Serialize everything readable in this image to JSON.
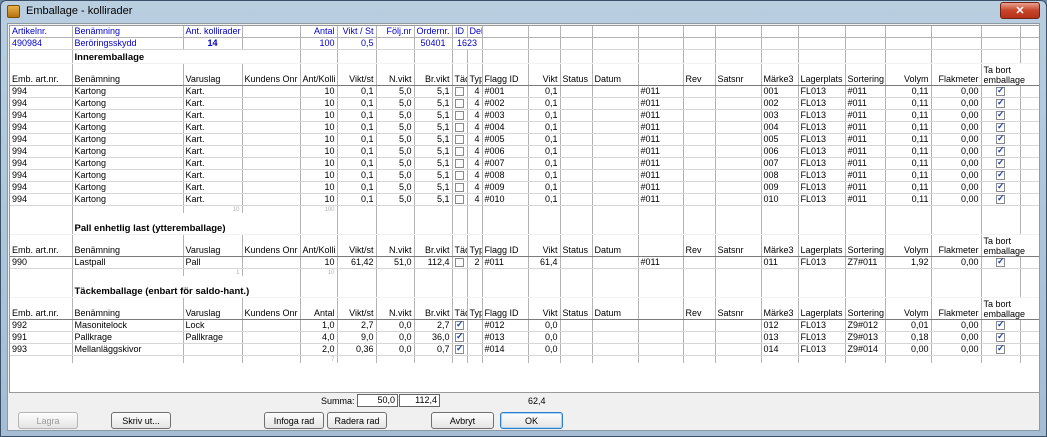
{
  "window": {
    "title": "Emballage - kollirader",
    "close_glyph": "✕"
  },
  "header": {
    "labels": [
      "Artikelnr.",
      "Benämning",
      "Ant. kollirader",
      "Antal",
      "Vikt / St",
      "Följ.nr",
      "Ordernr.",
      "ID",
      "Del"
    ],
    "values": {
      "artikelnr": "490984",
      "benamning": "Beröringsskydd",
      "ant_kollirader": "14",
      "antal": "100",
      "vikt_st": "0,5",
      "ordernr": "50401",
      "id": "1623"
    }
  },
  "sections": [
    {
      "title": "Inneremballage",
      "columns": [
        "Emb. art.nr.",
        "Benämning",
        "Varuslag",
        "Kundens Onr",
        "Ant/Kolli",
        "Vikt/st",
        "N.vikt",
        "Br.vikt",
        "Täck.",
        "Typ",
        "Flagg ID",
        "Vikt",
        "Status",
        "Datum",
        "",
        "Rev",
        "Satsnr",
        "Märke3",
        "Lagerplats",
        "Sortering",
        "Volym",
        "Flakmeter",
        "Ta bort emballage"
      ],
      "rows": [
        [
          "994",
          "Kartong",
          "Kart.",
          "",
          "10",
          "0,1",
          "5,0",
          "5,1",
          false,
          "4",
          "#001",
          "0,1",
          "",
          "",
          "#011",
          "",
          "",
          "001",
          "FL013",
          "#011",
          "0,11",
          "0,00",
          true
        ],
        [
          "994",
          "Kartong",
          "Kart.",
          "",
          "10",
          "0,1",
          "5,0",
          "5,1",
          false,
          "4",
          "#002",
          "0,1",
          "",
          "",
          "#011",
          "",
          "",
          "002",
          "FL013",
          "#011",
          "0,11",
          "0,00",
          true
        ],
        [
          "994",
          "Kartong",
          "Kart.",
          "",
          "10",
          "0,1",
          "5,0",
          "5,1",
          false,
          "4",
          "#003",
          "0,1",
          "",
          "",
          "#011",
          "",
          "",
          "003",
          "FL013",
          "#011",
          "0,11",
          "0,00",
          true
        ],
        [
          "994",
          "Kartong",
          "Kart.",
          "",
          "10",
          "0,1",
          "5,0",
          "5,1",
          false,
          "4",
          "#004",
          "0,1",
          "",
          "",
          "#011",
          "",
          "",
          "004",
          "FL013",
          "#011",
          "0,11",
          "0,00",
          true
        ],
        [
          "994",
          "Kartong",
          "Kart.",
          "",
          "10",
          "0,1",
          "5,0",
          "5,1",
          false,
          "4",
          "#005",
          "0,1",
          "",
          "",
          "#011",
          "",
          "",
          "005",
          "FL013",
          "#011",
          "0,11",
          "0,00",
          true
        ],
        [
          "994",
          "Kartong",
          "Kart.",
          "",
          "10",
          "0,1",
          "5,0",
          "5,1",
          false,
          "4",
          "#006",
          "0,1",
          "",
          "",
          "#011",
          "",
          "",
          "006",
          "FL013",
          "#011",
          "0,11",
          "0,00",
          true
        ],
        [
          "994",
          "Kartong",
          "Kart.",
          "",
          "10",
          "0,1",
          "5,0",
          "5,1",
          false,
          "4",
          "#007",
          "0,1",
          "",
          "",
          "#011",
          "",
          "",
          "007",
          "FL013",
          "#011",
          "0,11",
          "0,00",
          true
        ],
        [
          "994",
          "Kartong",
          "Kart.",
          "",
          "10",
          "0,1",
          "5,0",
          "5,1",
          false,
          "4",
          "#008",
          "0,1",
          "",
          "",
          "#011",
          "",
          "",
          "008",
          "FL013",
          "#011",
          "0,11",
          "0,00",
          true
        ],
        [
          "994",
          "Kartong",
          "Kart.",
          "",
          "10",
          "0,1",
          "5,0",
          "5,1",
          false,
          "4",
          "#009",
          "0,1",
          "",
          "",
          "#011",
          "",
          "",
          "009",
          "FL013",
          "#011",
          "0,11",
          "0,00",
          true
        ],
        [
          "994",
          "Kartong",
          "Kart.",
          "",
          "10",
          "0,1",
          "5,0",
          "5,1",
          false,
          "4",
          "#010",
          "0,1",
          "",
          "",
          "#011",
          "",
          "",
          "010",
          "FL013",
          "#011",
          "0,11",
          "0,00",
          true
        ]
      ],
      "tracker": [
        "10",
        "100"
      ]
    },
    {
      "title": "Pall enhetlig last (ytteremballage)",
      "columns": [
        "Emb. art.nr.",
        "Benämning",
        "Varuslag",
        "Kundens Onr",
        "Ant/Kolli",
        "Vikt/st",
        "N.vikt",
        "Br.vikt",
        "Täck.",
        "Typ",
        "Flagg ID",
        "Vikt",
        "Status",
        "Datum",
        "",
        "Rev",
        "Satsnr",
        "Märke3",
        "Lagerplats",
        "Sortering",
        "Volym",
        "Flakmeter",
        "Ta bort emballage"
      ],
      "rows": [
        [
          "990",
          "Lastpall",
          "Pall",
          "",
          "10",
          "61,42",
          "51,0",
          "112,4",
          false,
          "2",
          "#011",
          "61,4",
          "",
          "",
          "#011",
          "",
          "",
          "011",
          "FL013",
          "Z7#011",
          "1,92",
          "0,00",
          true
        ]
      ],
      "tracker": [
        "1",
        "10"
      ]
    },
    {
      "title": "Täckemballage (enbart för saldo-hant.)",
      "columns": [
        "Emb. art.nr.",
        "Benämning",
        "Varuslag",
        "Kundens Onr",
        "Antal",
        "Vikt/st",
        "N.vikt",
        "Br.vikt",
        "Täck.",
        "Typ",
        "Flagg ID",
        "Vikt",
        "Status",
        "Datum",
        "",
        "Rev",
        "Satsnr",
        "Märke3",
        "Lagerplats",
        "Sortering",
        "Volym",
        "Flakmeter",
        "Ta bort emballage"
      ],
      "rows": [
        [
          "992",
          "Masonitelock",
          "Lock",
          "",
          "1,0",
          "2,7",
          "0,0",
          "2,7",
          true,
          "",
          "#012",
          "0,0",
          "",
          "",
          "",
          "",
          "",
          "012",
          "FL013",
          "Z9#012",
          "0,01",
          "0,00",
          true
        ],
        [
          "991",
          "Pallkrage",
          "Pallkrage",
          "",
          "4,0",
          "9,0",
          "0,0",
          "36,0",
          true,
          "",
          "#013",
          "0,0",
          "",
          "",
          "",
          "",
          "",
          "013",
          "FL013",
          "Z9#013",
          "0,18",
          "0,00",
          true
        ],
        [
          "993",
          "Mellanläggskivor",
          "",
          "",
          "2,0",
          "0,36",
          "0,0",
          "0,7",
          true,
          "",
          "#014",
          "0,0",
          "",
          "",
          "",
          "",
          "",
          "014",
          "FL013",
          "Z9#014",
          "0,00",
          "0,00",
          true
        ]
      ],
      "tracker": [
        "7"
      ]
    }
  ],
  "summary": {
    "label": "Summa:",
    "nvikt": "50,0",
    "brvikt": "112,4",
    "vikt": "62,4"
  },
  "buttons": {
    "lagra": "Lagra",
    "skriv_ut": "Skriv ut...",
    "infoga_rad": "Infoga rad",
    "radera_rad": "Radera rad",
    "avbryt": "Avbryt",
    "ok": "OK"
  }
}
